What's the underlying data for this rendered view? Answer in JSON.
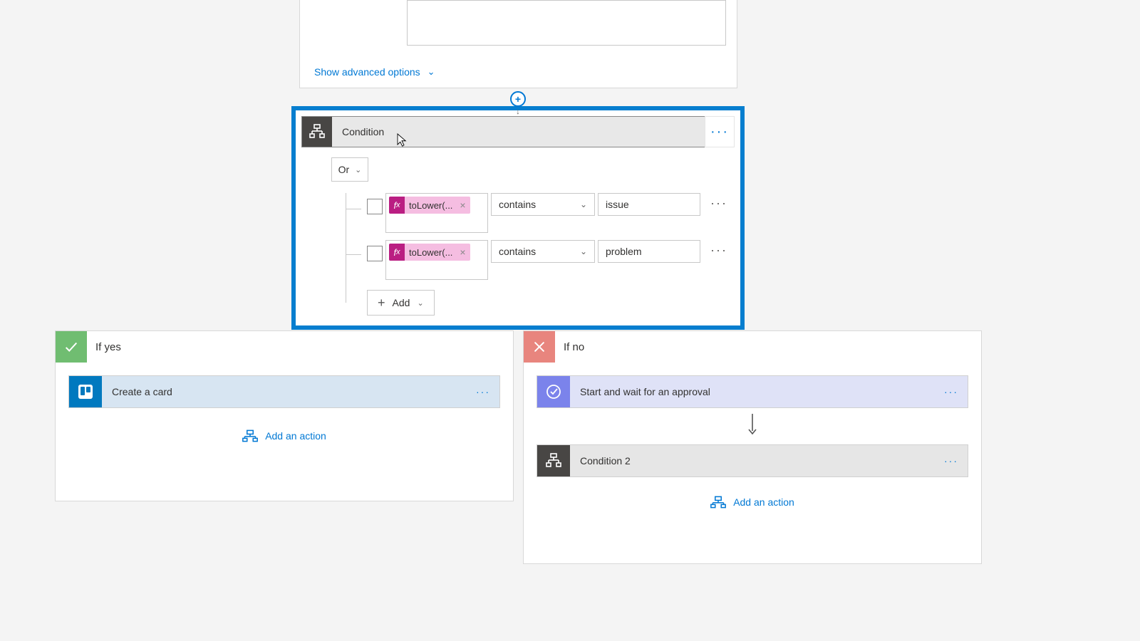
{
  "top": {
    "show_advanced": "Show advanced options"
  },
  "condition": {
    "title": "Condition",
    "group_operator": "Or",
    "add_label": "Add",
    "rows": [
      {
        "expression": "toLower(...",
        "operator": "contains",
        "value": "issue"
      },
      {
        "expression": "toLower(...",
        "operator": "contains",
        "value": "problem"
      }
    ]
  },
  "branches": {
    "yes": {
      "label": "If yes",
      "action_title": "Create a card",
      "add_action": "Add an action"
    },
    "no": {
      "label": "If no",
      "action1_title": "Start and wait for an approval",
      "action2_title": "Condition 2",
      "add_action": "Add an action"
    }
  }
}
